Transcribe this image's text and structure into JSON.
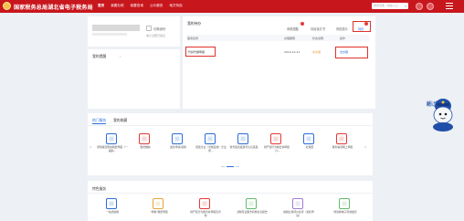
{
  "header": {
    "site_title": "国家税务总局湖北省电子税务局",
    "nav": [
      "首页",
      "我要办税",
      "我要查询",
      "公众服务",
      "地方特色"
    ],
    "search_placeholder": "搜索功能 / 快捷入口"
  },
  "user_card": {
    "switch_label": "切换身份",
    "sub_link": "电子证照已验证"
  },
  "reminder": {
    "title": "我的提醒"
  },
  "todo": {
    "title": "我的待办",
    "tabs": [
      "申报提醒",
      "待阅读文书",
      "风险提示",
      "待办"
    ],
    "active_tab": "待办",
    "badge_count": "0",
    "columns": [
      "事项名称",
      "办理期限",
      "状态说明",
      "操作"
    ],
    "rows": [
      {
        "name": "代扣代缴申报",
        "deadline": "2019-12-11",
        "status": "未办理",
        "action": "去办理"
      }
    ]
  },
  "hot": {
    "tabs": [
      "热门服务",
      "我的收藏"
    ],
    "items": [
      {
        "label": "增值税及附加税费申报（一般纳...",
        "icon": "tax-declare-icon",
        "color": "#2a6dd9"
      },
      {
        "label": "税费缴纳",
        "icon": "payment-icon",
        "color": "#e53935"
      },
      {
        "label": "发票申领/领用",
        "icon": "invoice-icon",
        "color": "#2a6dd9"
      },
      {
        "label": "居民企业（查账征收）企业所...",
        "icon": "income-tax-icon",
        "color": "#2a6dd9"
      },
      {
        "label": "财务报表报送与信息采集",
        "icon": "report-icon",
        "color": "#2a6dd9"
      },
      {
        "label": "财产和行为税合并申报（小...",
        "icon": "property-tax-icon",
        "color": "#e53935"
      },
      {
        "label": "社保费",
        "icon": "social-icon",
        "color": "#2a6dd9"
      },
      {
        "label": "税务事项网上申报",
        "icon": "cloud-tax-icon",
        "color": "#e53935"
      }
    ]
  },
  "mine": {
    "title": "特色服务",
    "items": [
      {
        "label": "一站式纳税",
        "icon": "onestop-icon",
        "color": "#2a6dd9"
      },
      {
        "label": "\"非税\"税费申报",
        "icon": "nontax-icon",
        "color": "#e8a33c"
      },
      {
        "label": "财产和行为税合并申报及查询",
        "icon": "property-icon",
        "color": "#e53935"
      },
      {
        "label": "涉税专业服务机构信息报告",
        "icon": "agency-icon",
        "color": "#67b96c"
      },
      {
        "label": "纳税信用评价复评（复核申请）",
        "icon": "credit-icon",
        "color": "#a07bd6"
      },
      {
        "label": "增值税电子普通发票",
        "icon": "einvoice-icon",
        "color": "#67b96c"
      }
    ]
  },
  "mascot": {
    "caption": "纳税人之家"
  }
}
